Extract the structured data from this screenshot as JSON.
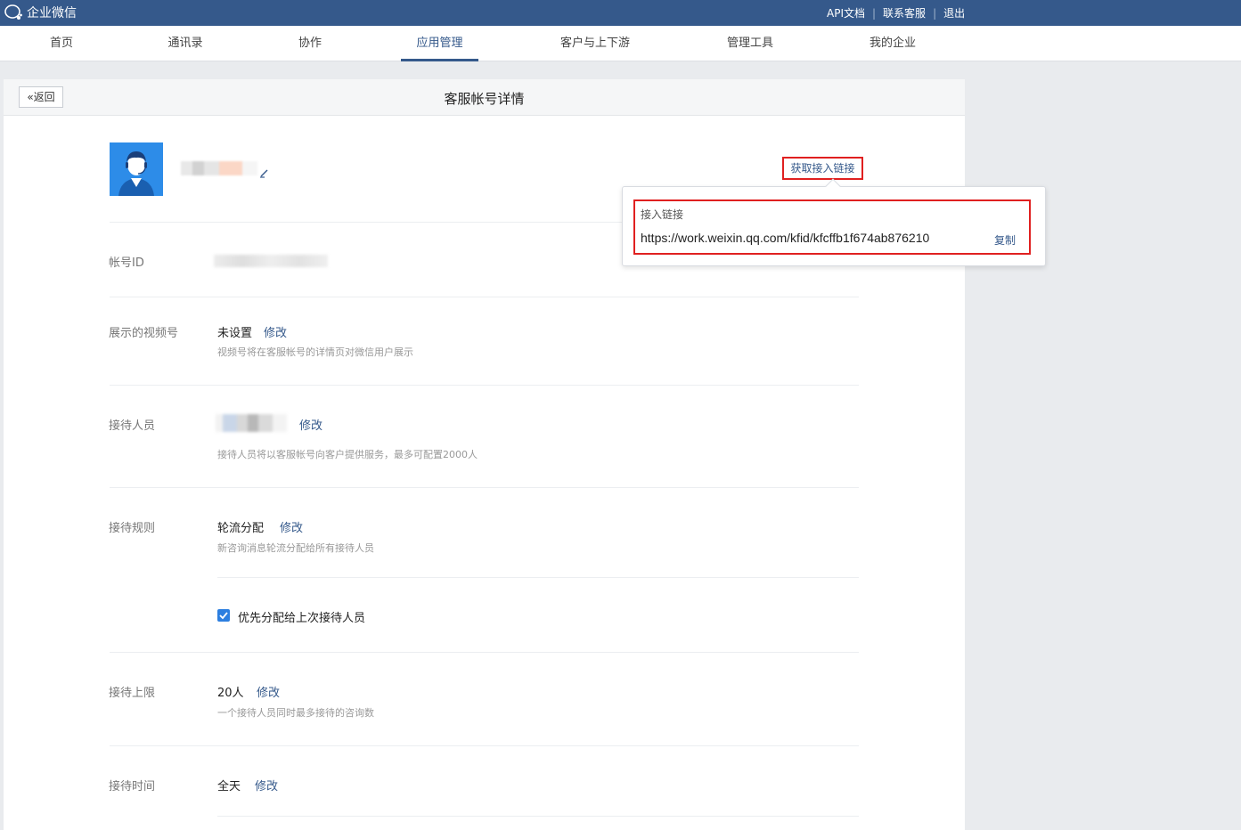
{
  "app": {
    "name": "企业微信"
  },
  "topbar": {
    "links": [
      "API文档",
      "联系客服",
      "退出"
    ]
  },
  "nav": {
    "items": [
      "首页",
      "通讯录",
      "协作",
      "应用管理",
      "客户与上下游",
      "管理工具",
      "我的企业"
    ],
    "active": "应用管理"
  },
  "page": {
    "back_label": "返回",
    "title": "客服帐号详情",
    "get_link_label": "获取接入链接"
  },
  "popover": {
    "title": "接入链接",
    "url": "https://work.weixin.qq.com/kfid/kfcffb1f674ab876210",
    "copy_label": "复制"
  },
  "fields": {
    "account_id": {
      "label": "帐号ID"
    },
    "channel": {
      "label": "展示的视频号",
      "value": "未设置",
      "modify": "修改",
      "hint": "视频号将在客服帐号的详情页对微信用户展示"
    },
    "staff": {
      "label": "接待人员",
      "modify": "修改",
      "hint": "接待人员将以客服帐号向客户提供服务，最多可配置2000人"
    },
    "rule": {
      "label": "接待规则",
      "value": "轮流分配",
      "modify": "修改",
      "hint": "新咨询消息轮流分配给所有接待人员",
      "checkbox_label": "优先分配给上次接待人员",
      "checkbox_checked": true
    },
    "limit": {
      "label": "接待上限",
      "value": "20人",
      "modify": "修改",
      "hint": "一个接待人员同时最多接待的咨询数"
    },
    "time": {
      "label": "接待时间",
      "value": "全天",
      "modify": "修改"
    }
  },
  "colors": {
    "topbar": "#35598b",
    "accent": "#35598b",
    "highlight": "#e02020",
    "avatar_bg": "#2d8ce8"
  }
}
